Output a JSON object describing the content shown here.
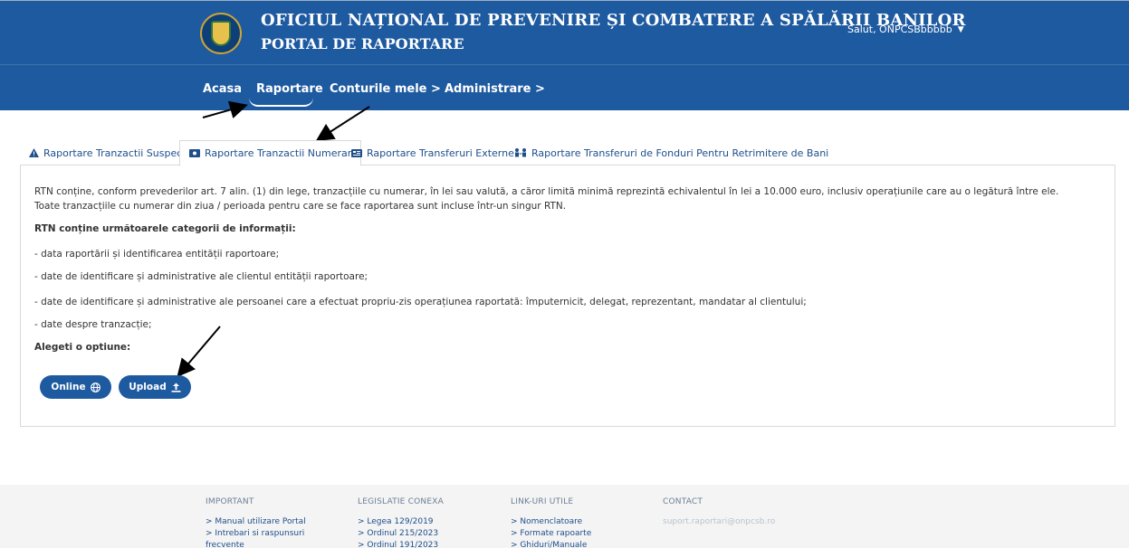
{
  "header": {
    "title_line1": "OFICIUL NAȚIONAL DE PREVENIRE ȘI COMBATERE A SPĂLĂRII BANILOR",
    "title_line2": "PORTAL DE RAPORTARE",
    "user_greeting": "Salut, ONPCSBbbbbb",
    "user_caret": "▼"
  },
  "nav": {
    "items": [
      {
        "label": "Acasa"
      },
      {
        "label": "Raportare"
      },
      {
        "label": "Conturile mele  >"
      },
      {
        "label": "Administrare  >"
      }
    ]
  },
  "tabs": [
    {
      "label": "Raportare Tranzactii Suspecte",
      "icon": "warning-icon"
    },
    {
      "label": "Raportare Tranzactii Numerar",
      "icon": "cash-icon"
    },
    {
      "label": "Raportare Transferuri Externe",
      "icon": "id-card-icon"
    },
    {
      "label": "Raportare Transferuri de Fonduri Pentru Retrimitere de Bani",
      "icon": "people-transfer-icon"
    }
  ],
  "content": {
    "para1": "RTN conține, conform prevederilor art. 7 alin. (1) din lege, tranzacțiile cu numerar, în lei sau valută, a căror limită minimă reprezintă echivalentul în lei a 10.000 euro, inclusiv operațiunile care au o legătură între ele.",
    "para2": "Toate tranzacțiile cu numerar din ziua / perioada pentru care se face raportarea sunt incluse într-un singur RTN.",
    "categories_heading": "RTN conține următoarele categorii de informații:",
    "items": [
      "- data raportării și identificarea entității raportoare;",
      "- date de identificare și administrative ale clientul entității raportoare;",
      "- date de identificare și administrative ale persoanei care a efectuat propriu-zis operațiunea raportată: împuternicit, delegat, reprezentant, mandatar al clientului;",
      "- date despre tranzacție;"
    ],
    "choose_label": "Alegeti o optiune:",
    "btn_online": "Online",
    "btn_upload": "Upload"
  },
  "footer": {
    "important": {
      "heading": "IMPORTANT",
      "links": [
        "> Manual utilizare Portal",
        "> Intrebari si raspunsuri",
        "frecvente"
      ]
    },
    "legislatie": {
      "heading": "LEGISLATIE CONEXA",
      "links": [
        "> Legea 129/2019",
        "> Ordinul 215/2023",
        "> Ordinul 191/2023"
      ]
    },
    "linkuri": {
      "heading": "LINK-URI UTILE",
      "links": [
        "> Nomenclatoare",
        "> Formate rapoarte",
        "> Ghiduri/Manuale"
      ]
    },
    "contact": {
      "heading": "CONTACT",
      "email": "suport.raportari@onpcsb.ro"
    }
  },
  "colors": {
    "brand_blue": "#1e5aa0",
    "link_blue": "#1e4e8c"
  }
}
